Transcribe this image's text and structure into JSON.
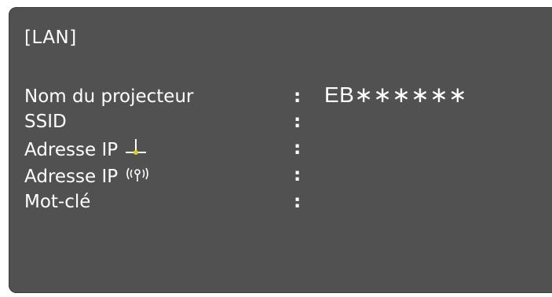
{
  "panel": {
    "title": "[LAN]"
  },
  "rows": [
    {
      "label": "Nom du projecteur",
      "separator": ":",
      "value": "EB∗∗∗∗∗∗"
    },
    {
      "label": "SSID",
      "separator": ":",
      "value": ""
    },
    {
      "label": "Adresse IP",
      "icon": "wired-lan-icon",
      "separator": ":",
      "value": ""
    },
    {
      "label": "Adresse IP",
      "icon": "wireless-icon",
      "separator": ":",
      "value": ""
    },
    {
      "label": "Mot-clé",
      "separator": ":",
      "value": ""
    }
  ]
}
